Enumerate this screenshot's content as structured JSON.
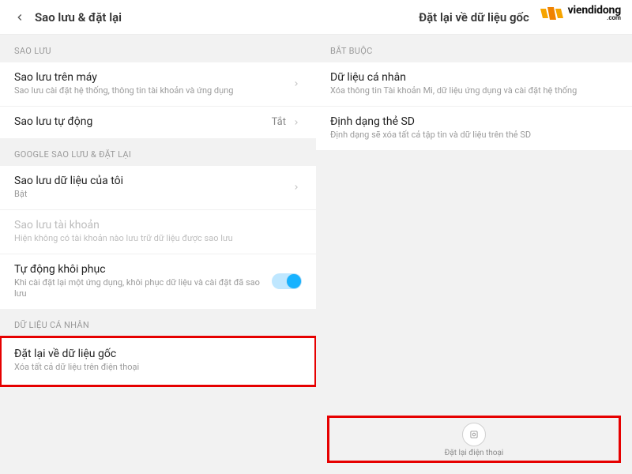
{
  "watermark": {
    "brand": "viendidong",
    "domain": ".com"
  },
  "left": {
    "header_title": "Sao lưu & đặt lại",
    "sections": {
      "backup": {
        "label": "SAO LƯU",
        "local": {
          "title": "Sao lưu trên máy",
          "sub": "Sao lưu cài đặt hệ thống, thông tin tài khoản và ứng dụng"
        },
        "auto": {
          "title": "Sao lưu tự động",
          "value": "Tắt"
        }
      },
      "google": {
        "label": "GOOGLE SAO LƯU & ĐẶT LẠI",
        "mydata": {
          "title": "Sao lưu dữ liệu của tôi",
          "sub": "Bật"
        },
        "account": {
          "title": "Sao lưu tài khoản",
          "sub": "Hiện không có tài khoản nào lưu trữ dữ liệu được sao lưu"
        },
        "autorestore": {
          "title": "Tự động khôi phục",
          "sub": "Khi cài đặt lại một ứng dụng, khôi phục dữ liệu và cài đặt đã sao lưu"
        }
      },
      "personal": {
        "label": "DỮ LIỆU CÁ NHÂN",
        "factory": {
          "title": "Đặt lại về dữ liệu gốc",
          "sub": "Xóa tất cả dữ liệu trên điện thoại"
        }
      }
    }
  },
  "right": {
    "header_title": "Đặt lại về dữ liệu gốc",
    "sections": {
      "required": {
        "label": "BẮT BUỘC",
        "personal": {
          "title": "Dữ liệu cá nhân",
          "sub": "Xóa thông tin Tài khoản Mi, dữ liệu ứng dụng và cài đặt hệ thống"
        },
        "sdformat": {
          "title": "Định dạng thẻ SD",
          "sub": "Định dạng sẽ xóa tất cả tập tin và dữ liệu trên thẻ SD"
        }
      }
    },
    "reset_button": {
      "icon_name": "reset-icon",
      "label": "Đặt lại điện thoại"
    }
  }
}
